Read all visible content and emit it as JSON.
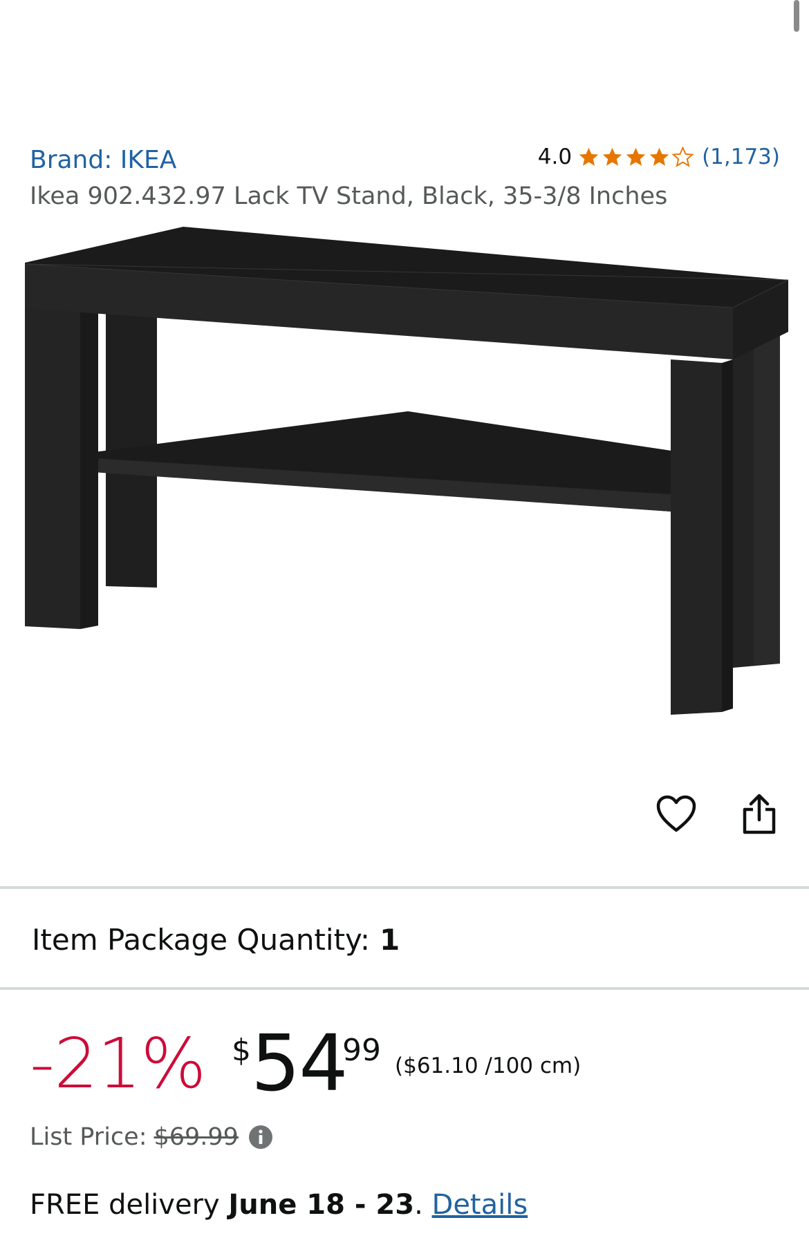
{
  "product": {
    "brand": "Brand: IKEA",
    "rating_value": "4.0",
    "rating_stars": 4,
    "rating_max": 5,
    "rating_count": "(1,173)",
    "title": "Ikea 902.432.97 Lack TV Stand, Black, 35-3/8 Inches"
  },
  "quantity": {
    "label": "Item Package Quantity:",
    "value": "1"
  },
  "price": {
    "discount": "-21%",
    "currency": "$",
    "whole": "54",
    "fraction": "99",
    "unit_price": "($61.10 /100 cm)",
    "list_label": "List Price:",
    "list_value": "$69.99"
  },
  "delivery": {
    "prefix": "FREE delivery ",
    "date": "June 18 - 23",
    "separator": ". ",
    "details": "Details"
  },
  "icons": {
    "wishlist": "heart-icon",
    "share": "share-icon",
    "info": "info-icon"
  },
  "colors": {
    "link": "#2162a1",
    "star": "#e77600",
    "discount": "#cc0c39",
    "divider": "#d5d9d9"
  }
}
